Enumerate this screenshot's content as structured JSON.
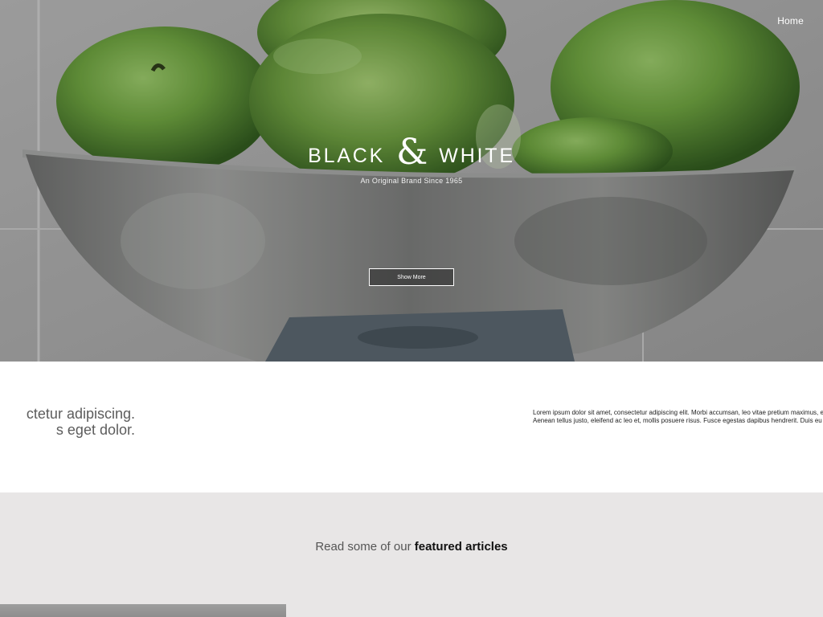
{
  "nav": {
    "home_label": "Home"
  },
  "hero": {
    "brand_word_left": "BLACK",
    "brand_ampersand": "&",
    "brand_word_right": "WHITE",
    "tagline": "An Original Brand Since 1965",
    "cta_label": "Show More"
  },
  "intro": {
    "headline_line1": "ctetur adipiscing.",
    "headline_line2": "s eget dolor.",
    "body_line1": "Lorem ipsum dolor sit amet, consectetur adipiscing elit. Morbi accumsan, leo vitae pretium maximus, elit risu",
    "body_line2": "Aenean tellus justo, eleifend ac leo et, mollis posuere risus. Fusce egestas dapibus hendrerit. Duis eu est en"
  },
  "featured": {
    "heading_prefix": "Read some of our",
    "heading_strong": "featured articles"
  },
  "colors": {
    "apple_green": "#6aa03c",
    "bowl_steel": "#8b8d8c",
    "featured_bg": "#e8e6e6",
    "text_gray": "#5c5c5c"
  }
}
